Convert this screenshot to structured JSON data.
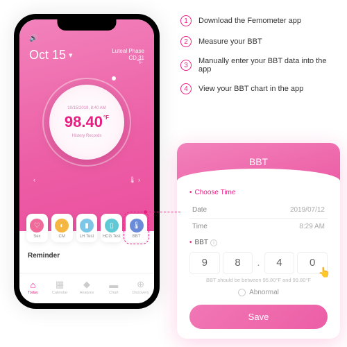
{
  "instructions": [
    "Download the Femometer app",
    "Measure your BBT",
    "Manually enter your BBT data into the app",
    "View your BBT chart in the app"
  ],
  "phone": {
    "date": "Oct 15",
    "phase_line1": "Luteal Phase",
    "phase_line2": "CD 31",
    "unit": "°F",
    "circle": {
      "timestamp": "10/15/2019, 8:40 AM",
      "temp": "98.40",
      "unit": "°F",
      "history": "History Records"
    },
    "categories": [
      {
        "label": "Sex",
        "color": "#f06b9a",
        "glyph": "♡"
      },
      {
        "label": "CM",
        "color": "#f5b642",
        "glyph": "◐"
      },
      {
        "label": "LH Test",
        "color": "#7cc7e8",
        "glyph": "▮"
      },
      {
        "label": "HCG Test",
        "color": "#5fc9d6",
        "glyph": "▯"
      },
      {
        "label": "BBT",
        "color": "#6a8cd8",
        "glyph": "🌡"
      }
    ],
    "reminder": "Reminder",
    "tabs": [
      {
        "label": "Today",
        "glyph": "⌂"
      },
      {
        "label": "Calendar",
        "glyph": "▦"
      },
      {
        "label": "Analysis",
        "glyph": "◆"
      },
      {
        "label": "Chart",
        "glyph": "▬"
      },
      {
        "label": "Discovery",
        "glyph": "⊕"
      }
    ]
  },
  "popup": {
    "title": "BBT",
    "choose_time": "Choose Time",
    "date_k": "Date",
    "date_v": "2019/07/12",
    "time_k": "Time",
    "time_v": "8:29 AM",
    "bbt_label": "BBT",
    "digits": [
      "9",
      "8",
      "4",
      "0"
    ],
    "hint": "BBT should be between 95.80°F and 99.80°F",
    "abnormal": "Abnormal",
    "save": "Save"
  }
}
